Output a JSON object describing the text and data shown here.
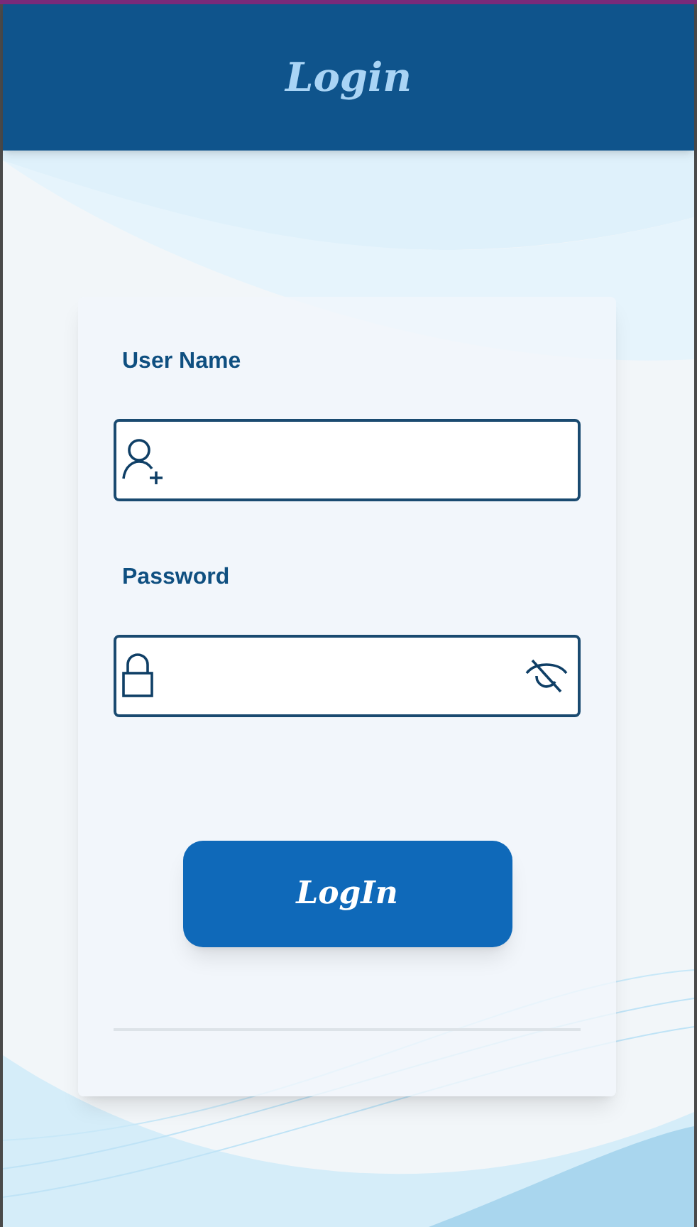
{
  "header": {
    "title": "Login"
  },
  "fields": [
    {
      "kind": "username",
      "label": "User Name"
    },
    {
      "kind": "password",
      "label": "Password",
      "visible": false
    }
  ],
  "button": {
    "label": "LogIn"
  }
}
